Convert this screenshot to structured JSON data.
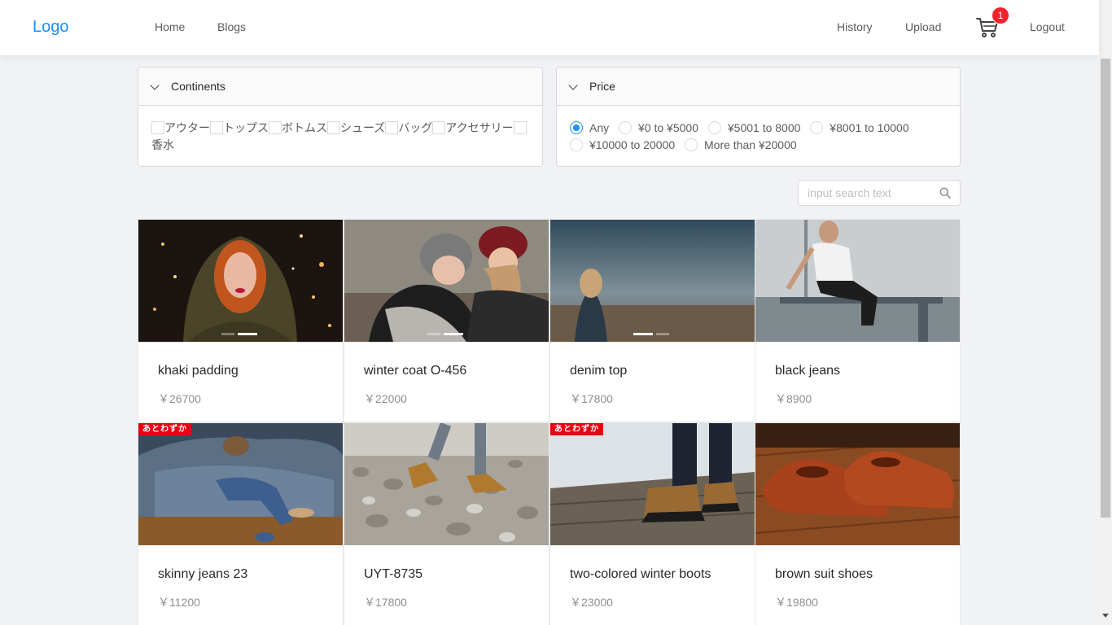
{
  "nav": {
    "logo": "Logo",
    "home": "Home",
    "blogs": "Blogs",
    "history": "History",
    "upload": "Upload",
    "cart_count": "1",
    "logout": "Logout"
  },
  "filters": {
    "continents": {
      "title": "Continents",
      "options": [
        "アウター",
        "トップス",
        "ボトムス",
        "シューズ",
        "バッグ",
        "アクセサリー",
        "香水"
      ]
    },
    "price": {
      "title": "Price",
      "options": [
        "Any",
        "¥0 to ¥5000",
        "¥5001 to 8000",
        "¥8001 to 10000",
        "¥10000 to 20000",
        "More than ¥20000"
      ],
      "selected": "Any"
    }
  },
  "search": {
    "placeholder": "input search text"
  },
  "products": [
    {
      "title": "khaki padding",
      "price": "￥26700"
    },
    {
      "title": "winter coat O-456",
      "price": "￥22000"
    },
    {
      "title": "denim top",
      "price": "￥17800"
    },
    {
      "title": "black jeans",
      "price": "￥8900"
    },
    {
      "title": "skinny jeans 23",
      "price": "￥11200",
      "tag": "あとわずか"
    },
    {
      "title": "UYT-8735",
      "price": "￥17800"
    },
    {
      "title": "two-colored winter boots",
      "price": "￥23000",
      "tag": "あとわずか"
    },
    {
      "title": "brown suit shoes",
      "price": "￥19800"
    }
  ],
  "colors": {
    "accent": "#1890ff",
    "badge": "#f5222d",
    "tag": "#e60012"
  }
}
